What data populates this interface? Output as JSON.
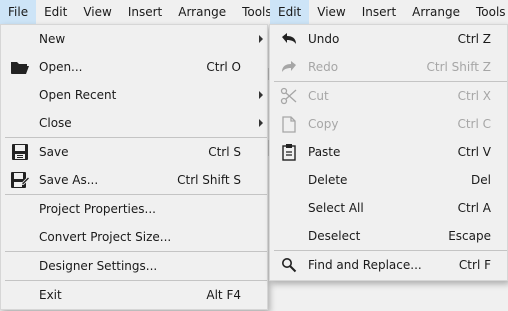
{
  "menubar": {
    "left": [
      "File",
      "Edit",
      "View",
      "Insert",
      "Arrange",
      "Tools"
    ],
    "right": [
      "Edit",
      "View",
      "Insert",
      "Arrange",
      "Tools"
    ]
  },
  "file_menu": {
    "new": "New",
    "open": "Open...",
    "open_sc": "Ctrl O",
    "open_recent": "Open Recent",
    "close": "Close",
    "save": "Save",
    "save_sc": "Ctrl S",
    "save_as": "Save As...",
    "save_as_sc": "Ctrl Shift S",
    "project_properties": "Project Properties...",
    "convert_project_size": "Convert Project Size...",
    "designer_settings": "Designer Settings...",
    "exit": "Exit",
    "exit_sc": "Alt F4"
  },
  "edit_menu": {
    "undo": "Undo",
    "undo_sc": "Ctrl Z",
    "redo": "Redo",
    "redo_sc": "Ctrl Shift Z",
    "cut": "Cut",
    "cut_sc": "Ctrl X",
    "copy": "Copy",
    "copy_sc": "Ctrl C",
    "paste": "Paste",
    "paste_sc": "Ctrl V",
    "delete": "Delete",
    "delete_sc": "Del",
    "select_all": "Select All",
    "select_all_sc": "Ctrl A",
    "deselect": "Deselect",
    "deselect_sc": "Escape",
    "find_replace": "Find and Replace...",
    "find_replace_sc": "Ctrl F"
  },
  "colors": {
    "highlight": "#cde4f7",
    "menu_bg": "#f0f0f0",
    "disabled": "#a6a6a6"
  }
}
